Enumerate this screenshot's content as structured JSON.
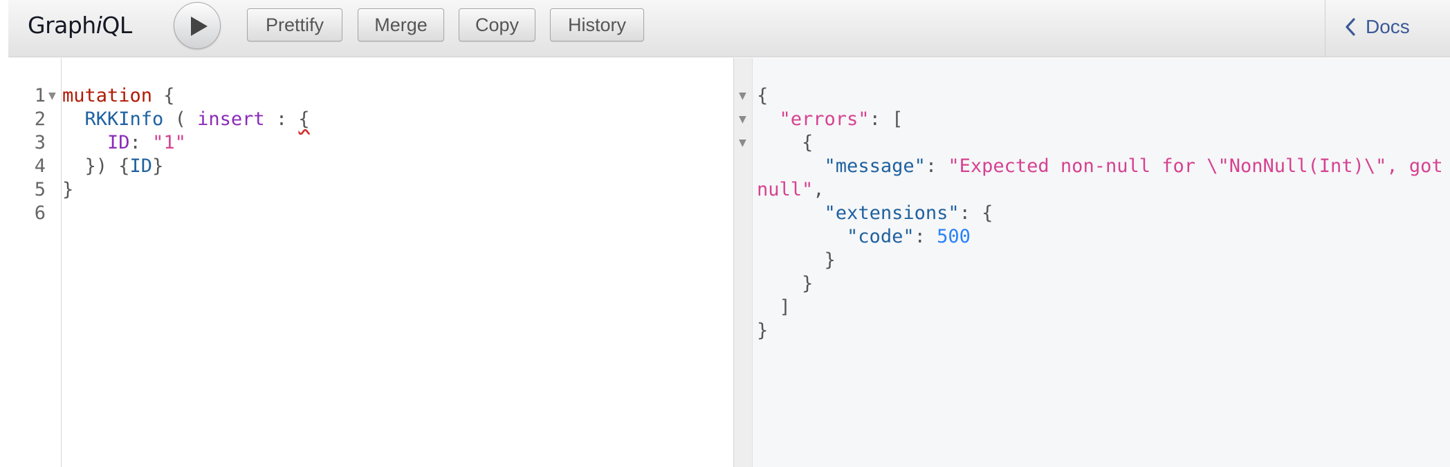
{
  "app": {
    "title_prefix": "Graph",
    "title_italic": "i",
    "title_suffix": "QL"
  },
  "toolbar": {
    "run_label": "Execute Query",
    "prettify": "Prettify",
    "merge": "Merge",
    "copy": "Copy",
    "history": "History",
    "docs": "Docs"
  },
  "editor": {
    "line_numbers": [
      "1",
      "2",
      "3",
      "4",
      "5",
      "6"
    ],
    "lines": [
      {
        "t1": "mutation",
        "t2": " {"
      },
      {
        "t1": "  ",
        "t2": "RKKInfo",
        "t3": " ( ",
        "t4": "insert",
        "t5": " : ",
        "t6": "{"
      },
      {
        "t1": "    ",
        "t2": "ID",
        "t3": ": ",
        "t4": "\"1\""
      },
      {
        "t1": "  }) {",
        "t2": "ID",
        "t3": "}"
      },
      {
        "t1": "}"
      },
      {
        "t1": ""
      }
    ]
  },
  "result": {
    "l1": "{",
    "l2_key": "\"errors\"",
    "l2_rest": ": [",
    "l3": "{",
    "l4_key": "\"message\"",
    "l4_colon": ": ",
    "l4_val": "\"Expected non-null for \\\"NonNull(Int)\\\", got",
    "l5_val": "null\"",
    "l5_rest": ",",
    "l6_key": "\"extensions\"",
    "l6_rest": ": {",
    "l7_key": "\"code\"",
    "l7_colon": ": ",
    "l7_val": "500",
    "l8": "}",
    "l9": "}",
    "l10": "]",
    "l11": "}"
  }
}
